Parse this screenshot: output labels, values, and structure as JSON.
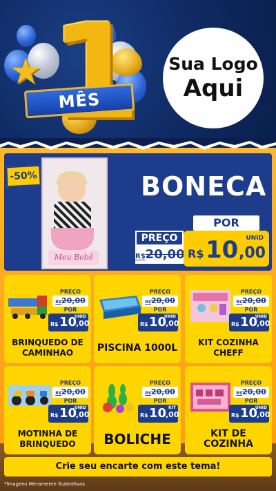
{
  "header": {
    "badge_number": "1",
    "badge_label": "MÊS",
    "logo_line1": "Sua Logo",
    "logo_line2": "Aqui"
  },
  "hero": {
    "discount": "-50%",
    "product_box_label": "Meu Bebê",
    "title": "BONECA",
    "preco_label": "PREÇO",
    "old_currency": "R$",
    "old_price": "20,00",
    "por_label": "POR",
    "unit": "UNID",
    "currency": "R$",
    "new_int": "10",
    "new_cents": ",00"
  },
  "products": [
    {
      "name": "BRINQUEDO DE CAMINHAO",
      "preco_label": "PREÇO",
      "old_currency": "R$",
      "old_price": "20,00",
      "por_label": "POR",
      "currency": "R$",
      "new_int": "10",
      "new_cents": ",00",
      "unit": "UNID",
      "picture": "toy-trucks"
    },
    {
      "name": "PISCINA 1000L",
      "preco_label": "PREÇO",
      "old_currency": "R$",
      "old_price": "20,00",
      "por_label": "POR",
      "currency": "R$",
      "new_int": "10",
      "new_cents": ",00",
      "unit": "UNID",
      "picture": "pool"
    },
    {
      "name": "KIT COZINHA CHEFF",
      "preco_label": "PREÇO",
      "old_currency": "R$",
      "old_price": "20,00",
      "por_label": "POR",
      "currency": "R$",
      "new_int": "10",
      "new_cents": ",00",
      "unit": "UNID",
      "picture": "kitchen-set"
    },
    {
      "name": "MOTINHA DE BRINQUEDO",
      "preco_label": "PREÇO",
      "old_currency": "R$",
      "old_price": "20,00",
      "por_label": "POR",
      "currency": "R$",
      "new_int": "10",
      "new_cents": ",00",
      "unit": "UNID",
      "picture": "toy-motorcycles"
    },
    {
      "name": "BOLICHE",
      "preco_label": "PREÇO",
      "old_currency": "R$",
      "old_price": "20,00",
      "por_label": "POR",
      "currency": "R$",
      "new_int": "10",
      "new_cents": ",00",
      "unit": "KIT",
      "picture": "bowling-set"
    },
    {
      "name": "KIT DE COZINHA",
      "preco_label": "PREÇO",
      "old_currency": "R$",
      "old_price": "20,00",
      "por_label": "POR",
      "currency": "R$",
      "new_int": "10",
      "new_cents": ",00",
      "unit": "UNID",
      "picture": "kitchen-kit"
    }
  ],
  "cta": "Crie seu encarte com este tema!",
  "note": "*Imagens Meramente Ilustrativas",
  "colors": {
    "navy": "#1e3c8c",
    "yellow": "#ffd500",
    "orange": "#ffa51b",
    "gold": "#f3b712"
  }
}
